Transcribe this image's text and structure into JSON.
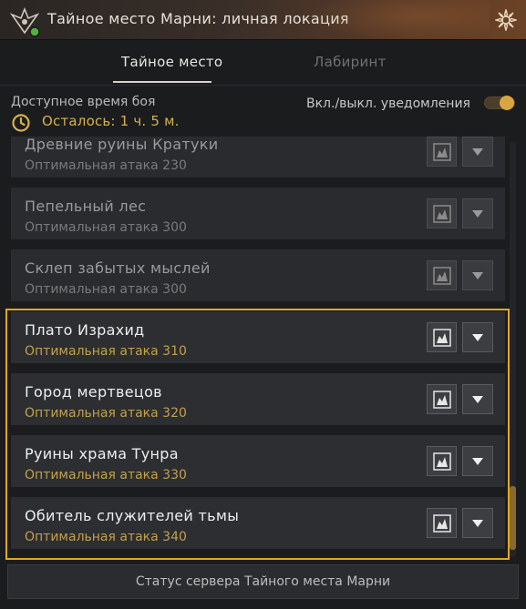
{
  "window": {
    "title": "Тайное место Марни: личная локация",
    "emblem_icon": "marni-emblem-icon",
    "settings_icon": "gear-flower-icon"
  },
  "tabs": [
    {
      "label": "Тайное место",
      "active": true
    },
    {
      "label": "Лабиринт",
      "active": false
    }
  ],
  "battle_time": {
    "label": "Доступное время боя",
    "remaining": "Осталось: 1 ч. 5 м.",
    "icon": "clock-icon",
    "accent_color": "#d7b14a"
  },
  "notifications": {
    "label": "Вкл./выкл. уведомления",
    "enabled": true
  },
  "locations": [
    {
      "name": "Древние руины Кратуки",
      "attack": "Оптимальная атака 230",
      "highlighted": false
    },
    {
      "name": "Пепельный лес",
      "attack": "Оптимальная атака 300",
      "highlighted": false
    },
    {
      "name": "Склеп забытых мыслей",
      "attack": "Оптимальная атака 300",
      "highlighted": false
    },
    {
      "name": "Плато Израхид",
      "attack": "Оптимальная атака 310",
      "highlighted": true
    },
    {
      "name": "Город мертвецов",
      "attack": "Оптимальная атака 320",
      "highlighted": true
    },
    {
      "name": "Руины храма Тунра",
      "attack": "Оптимальная атака 330",
      "highlighted": true
    },
    {
      "name": "Обитель служителей тьмы",
      "attack": "Оптимальная атака 340",
      "highlighted": true
    }
  ],
  "row_icons": {
    "info_icon": "location-card-icon",
    "expand_icon": "chevron-down-icon"
  },
  "highlight_color": "#e0aa1f",
  "footer": {
    "label": "Статус сервера Тайного места Марни"
  }
}
